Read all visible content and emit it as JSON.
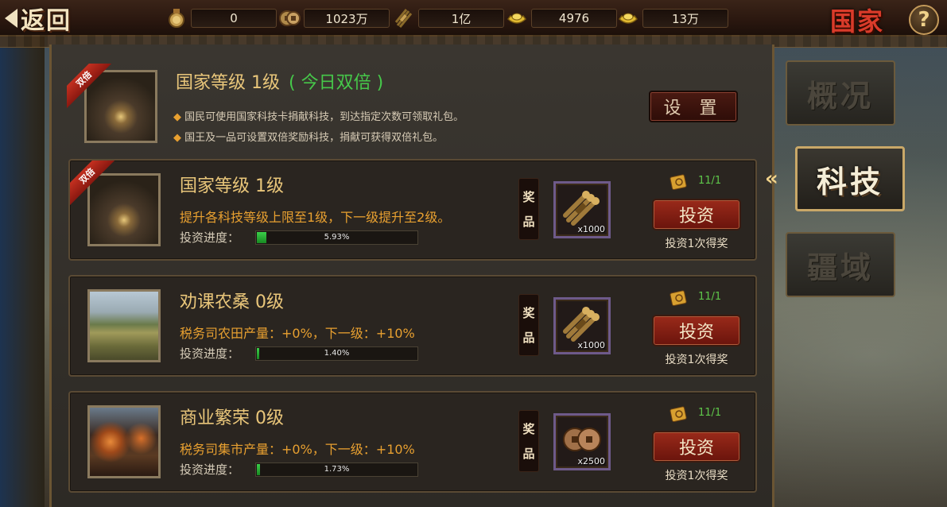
{
  "topbar": {
    "back_label": "返回",
    "title": "国家",
    "help_label": "?",
    "resources": [
      {
        "icon": "medal-icon",
        "value": "0"
      },
      {
        "icon": "coin-icon",
        "value": "1023万"
      },
      {
        "icon": "grain-bundle-icon",
        "value": "1亿"
      },
      {
        "icon": "gold-ingot-icon",
        "value": "4976"
      },
      {
        "icon": "gold-ingot-icon",
        "value": "13万"
      }
    ]
  },
  "header": {
    "title": "国家等级  1级",
    "double_today": "( 今日双倍 )",
    "double_badge": "双倍",
    "bullets": [
      "国民可使用国家科技卡捐献科技，到达指定次数可领取礼包。",
      "国王及一品可设置双倍奖励科技，捐献可获得双倍礼包。"
    ],
    "settings_label": "设 置"
  },
  "techs": [
    {
      "title": "国家等级  1级",
      "badge": "双倍",
      "desc": "提升各科技等级上限至1级，下一级提升至2级。",
      "progress_label": "投资进度：",
      "progress": 5.93,
      "progress_text": "5.93%",
      "prize_label_1": "奖",
      "prize_label_2": "品",
      "prize_icon": "grain-bundle-icon",
      "prize_count": "x1000",
      "ticket_count": "11/1",
      "invest_label": "投资",
      "invest_note": "投资1次得奖"
    },
    {
      "title": "劝课农桑  0级",
      "desc": "税务司农田产量：+0%，下一级：+10%",
      "progress_label": "投资进度：",
      "progress": 1.4,
      "progress_text": "1.40%",
      "prize_label_1": "奖",
      "prize_label_2": "品",
      "prize_icon": "grain-bundle-icon",
      "prize_count": "x1000",
      "ticket_count": "11/1",
      "invest_label": "投资",
      "invest_note": "投资1次得奖"
    },
    {
      "title": "商业繁荣  0级",
      "desc": "税务司集市产量：+0%，下一级：+10%",
      "progress_label": "投资进度：",
      "progress": 1.73,
      "progress_text": "1.73%",
      "prize_label_1": "奖",
      "prize_label_2": "品",
      "prize_icon": "coin-stack-icon",
      "prize_count": "x2500",
      "ticket_count": "11/1",
      "invest_label": "投资",
      "invest_note": "投资1次得奖"
    }
  ],
  "side_tabs": [
    {
      "label": "概况",
      "active": false
    },
    {
      "label": "科技",
      "active": true
    },
    {
      "label": "疆域",
      "active": false
    }
  ],
  "side_chevron": "«"
}
